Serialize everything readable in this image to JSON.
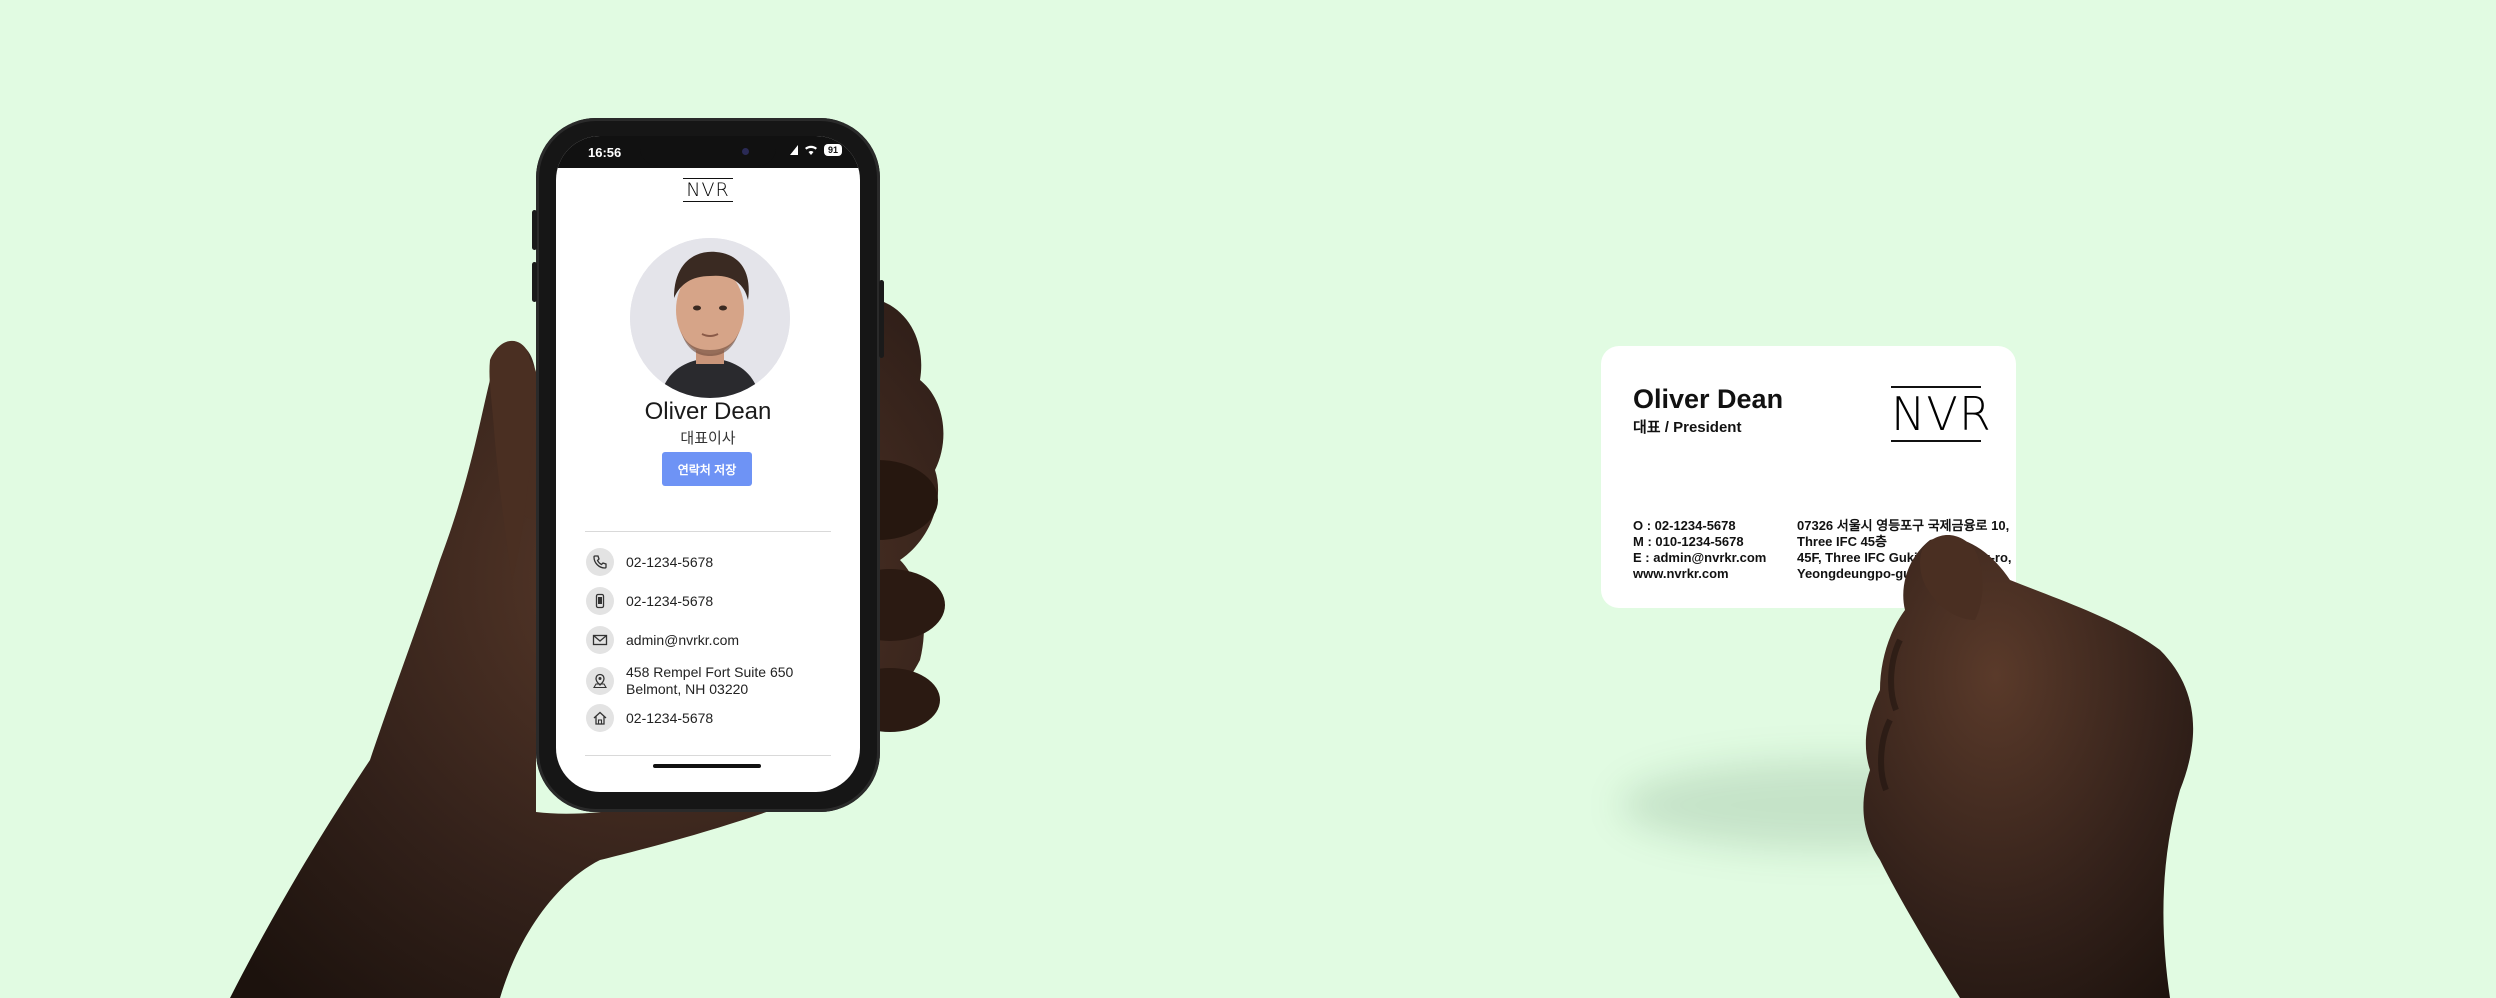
{
  "phone": {
    "status_time": "16:56",
    "battery_level": "91",
    "logo": "NVR",
    "person_name": "Oliver Dean",
    "person_title": "대표이사",
    "save_button_label": "연락처 저장",
    "contacts": [
      {
        "icon": "phone-icon",
        "text": "02-1234-5678"
      },
      {
        "icon": "mobile-icon",
        "text": "02-1234-5678"
      },
      {
        "icon": "mail-icon",
        "text": "admin@nvrkr.com"
      },
      {
        "icon": "location-icon",
        "text_line1": "458 Rempel Fort Suite 650",
        "text_line2": "Belmont, NH 03220"
      },
      {
        "icon": "home-icon",
        "text": "02-1234-5678"
      }
    ]
  },
  "card": {
    "name": "Oliver Dean",
    "title": "대표 / President",
    "logo": "NVR",
    "contact_lines": [
      "O : 02-1234-5678",
      "M : 010-1234-5678",
      "E : admin@nvrkr.com",
      "www.nvrkr.com"
    ],
    "address_lines": [
      "07326 서울시 영등포구 국제금융로 10,",
      "Three IFC 45층",
      "45F, Three IFC Gukjegeumyung-ro,",
      "Yeongdeungpo-gu, Seoul"
    ]
  },
  "colors": {
    "background": "#e1fbe2",
    "accent_button": "#6e93f5",
    "skin": "#3a2418"
  }
}
